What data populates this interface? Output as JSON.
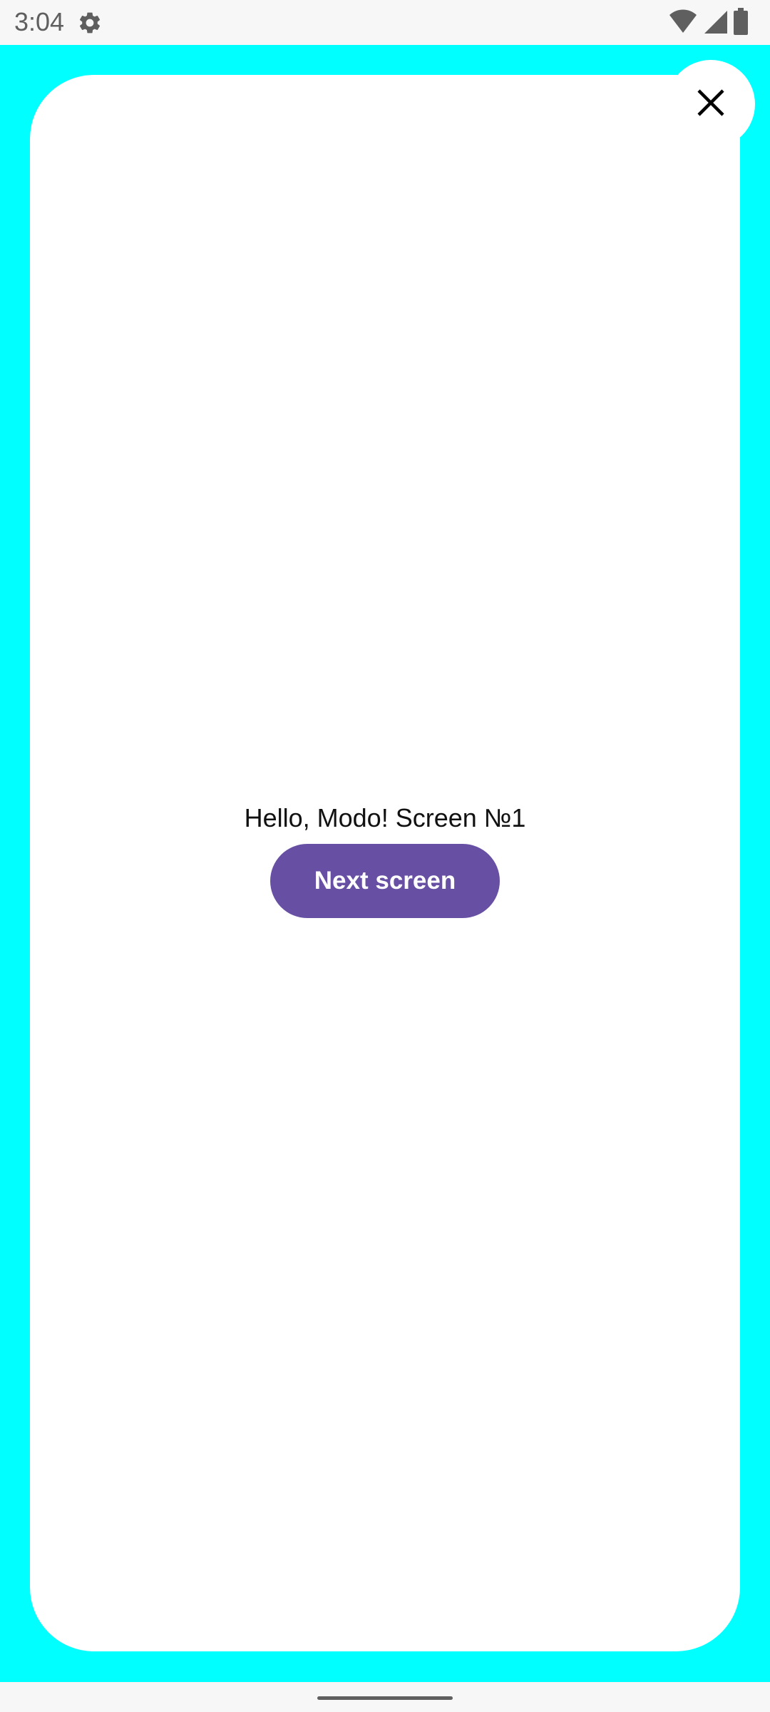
{
  "status_bar": {
    "time": "3:04",
    "icons": [
      "gear-icon",
      "wifi-icon",
      "cell-signal-icon",
      "battery-icon"
    ]
  },
  "colors": {
    "background": "#00ffff",
    "sheet": "#ffffff",
    "button": "#6750a4",
    "button_text": "#ffffff"
  },
  "sheet": {
    "close_icon": "close-icon",
    "greeting": "Hello, Modo! Screen №1",
    "next_button_label": "Next screen"
  }
}
